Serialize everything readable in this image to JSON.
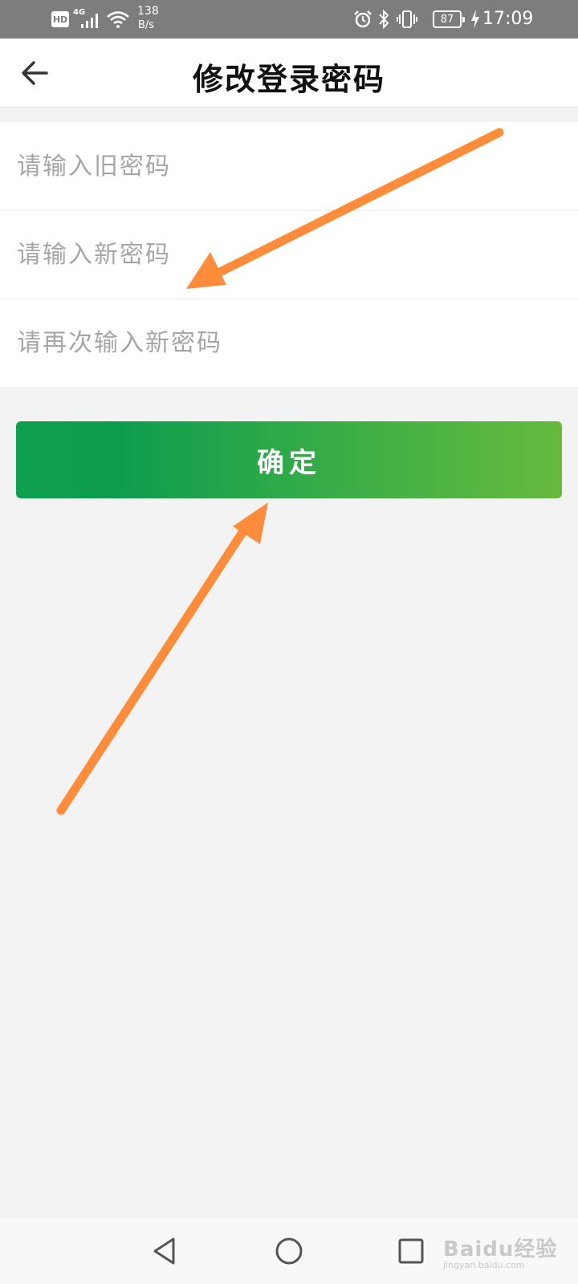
{
  "status_bar": {
    "hd_badge": "HD",
    "network_type": "4G",
    "speed_value": "138",
    "speed_unit": "B/s",
    "battery_level": "87",
    "time": "17:09",
    "icons": [
      "signal-icon",
      "wifi-icon",
      "alarm-icon",
      "bluetooth-icon",
      "vibrate-icon",
      "battery-icon",
      "charging-icon"
    ]
  },
  "header": {
    "title": "修改登录密码",
    "back_icon": "arrow-left-icon"
  },
  "form": {
    "old_password_placeholder": "请输入旧密码",
    "new_password_placeholder": "请输入新密码",
    "confirm_password_placeholder": "请再次输入新密码"
  },
  "confirm_button": {
    "label": "确定",
    "gradient_start": "#0ea04f",
    "gradient_end": "#66ba3e"
  },
  "annotations": {
    "arrow_color": "#ff8c3a"
  },
  "nav_bar": {
    "icons": [
      "back-triangle-icon",
      "home-circle-icon",
      "recents-square-icon"
    ]
  },
  "watermark": {
    "brand": "Baidu经验",
    "url": "jingyan.baidu.com"
  },
  "colors": {
    "background": "#f3f3f3",
    "status_bar": "#7d7d7d",
    "placeholder": "#a6a6a6"
  }
}
